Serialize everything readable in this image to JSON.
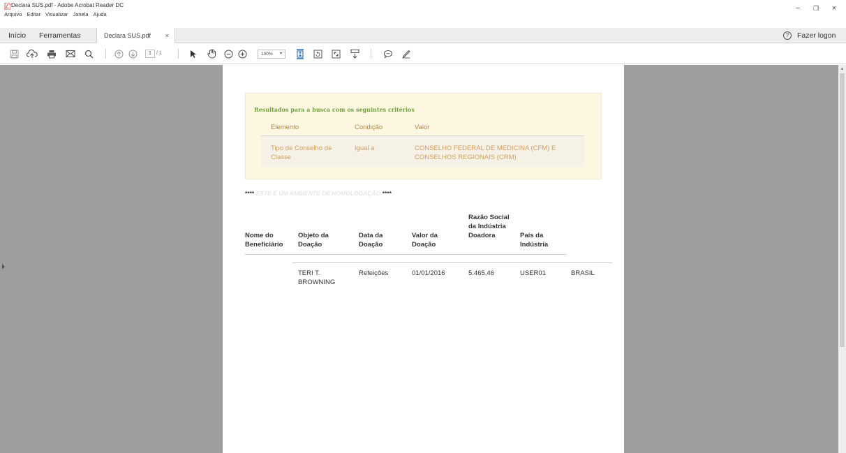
{
  "window": {
    "title": "Declara SUS.pdf - Adobe Acrobat Reader DC",
    "menu": [
      "Arquivo",
      "Editar",
      "Visualizar",
      "Janela",
      "Ajuda"
    ],
    "controls": {
      "minimize": "−",
      "restore": "❐",
      "close": "×"
    }
  },
  "tabs": {
    "home": "Início",
    "tools": "Ferramentas",
    "document": "Declara SUS.pdf",
    "close": "×",
    "help": "?",
    "logon": "Fazer logon"
  },
  "toolbar": {
    "page_current": "1",
    "page_total": "/ 1",
    "zoom": "100%",
    "zoom_arrow": "▾"
  },
  "document": {
    "criteria_title": "Resultados para a busca com os seguintes critérios",
    "criteria_headers": [
      "Elemento",
      "Condição",
      "Valor"
    ],
    "criteria_rows": [
      {
        "elemento": "Tipo de Conselho de Classe",
        "condicao": "Igual a",
        "valor": "CONSELHO FEDERAL DE MEDICINA (CFM) E CONSELHOS REGIONAIS (CRM)"
      }
    ],
    "homolog_stars": "****",
    "homolog_message": "ESTE É UM AMBIENTE DE HOMOLOGAÇÃO",
    "homolog_stars_end": "****",
    "table_headers": [
      "Nome do Beneficiário",
      "Objeto da Doação",
      "Data da Doação",
      "Valor da Doação",
      "Razão Social da Indústria Doadora",
      "País da Indústria"
    ],
    "table_rows": [
      [
        "TERI T. BROWNING",
        "Refeições",
        "01/01/2016",
        "5.465,46",
        "USER01",
        "BRASIL"
      ]
    ]
  },
  "colors": {
    "accent_green": "#6f9e3f",
    "criteria_text": "#cfa05d",
    "criteria_bg": "#fdf7e1",
    "workarea_bg": "#9e9e9e"
  },
  "icons": [
    "pdf-file-icon",
    "save-icon",
    "upload-icon",
    "print-icon",
    "email-icon",
    "search-icon",
    "prev-page-icon",
    "next-page-icon",
    "select-cursor-icon",
    "hand-icon",
    "zoom-out-icon",
    "zoom-in-icon",
    "fit-page-icon",
    "rotate-icon",
    "fullscreen-icon",
    "scroll-mode-icon",
    "comment-icon",
    "pen-icon",
    "help-icon"
  ]
}
